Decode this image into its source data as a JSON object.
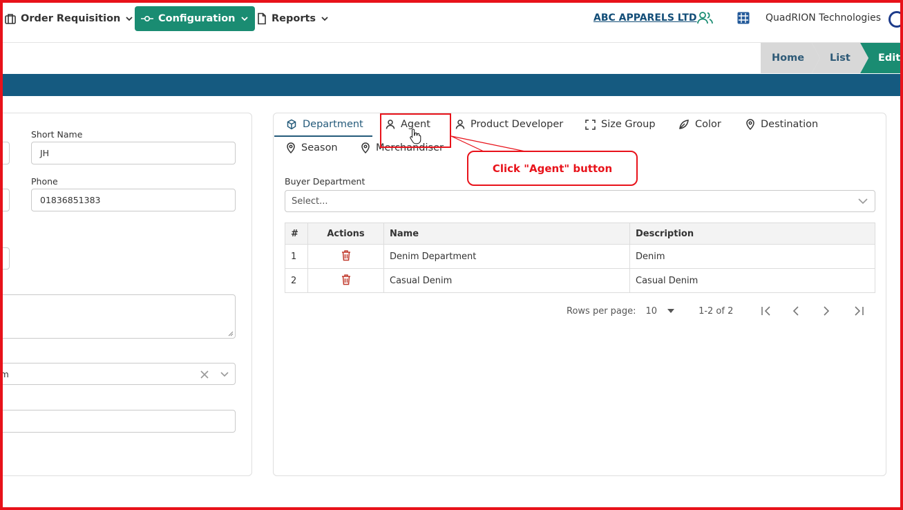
{
  "nav": {
    "order_requisition": "Order Requisition",
    "configuration": "Configuration",
    "reports": "Reports",
    "company": "ABC APPARELS LTD",
    "org": "QuadRION Technologies"
  },
  "breadcrumb": {
    "home": "Home",
    "list": "List",
    "edit": "Edit"
  },
  "left_form": {
    "short_name_label": "Short Name",
    "short_name_value": "JH",
    "phone_label": "Phone",
    "phone_value": "01836851383",
    "select_partial": "am"
  },
  "tabs": [
    {
      "label": "Department",
      "icon": "cube-icon",
      "active": true
    },
    {
      "label": "Agent",
      "icon": "user-icon"
    },
    {
      "label": "Product Developer",
      "icon": "user-icon"
    },
    {
      "label": "Size Group",
      "icon": "frame-icon"
    },
    {
      "label": "Color",
      "icon": "leaf-icon"
    },
    {
      "label": "Destination",
      "icon": "location-icon"
    },
    {
      "label": "Season",
      "icon": "location-icon"
    },
    {
      "label": "Merchandiser",
      "icon": "location-icon"
    }
  ],
  "buyer_department": {
    "label": "Buyer Department",
    "placeholder": "Select..."
  },
  "table": {
    "headers": [
      "#",
      "Actions",
      "Name",
      "Description"
    ],
    "rows": [
      {
        "num": "1",
        "name": "Denim Department",
        "description": "Denim"
      },
      {
        "num": "2",
        "name": "Casual Denim",
        "description": "Casual Denim"
      }
    ]
  },
  "pagination": {
    "rows_per_page_label": "Rows per page:",
    "rows_per_page": "10",
    "range": "1-2 of 2"
  },
  "annotation": {
    "callout": "Click \"Agent\" button"
  },
  "colors": {
    "accent": "#1a8c72",
    "band": "#155a80",
    "annotation": "#e8121a",
    "delete": "#c0392b"
  }
}
